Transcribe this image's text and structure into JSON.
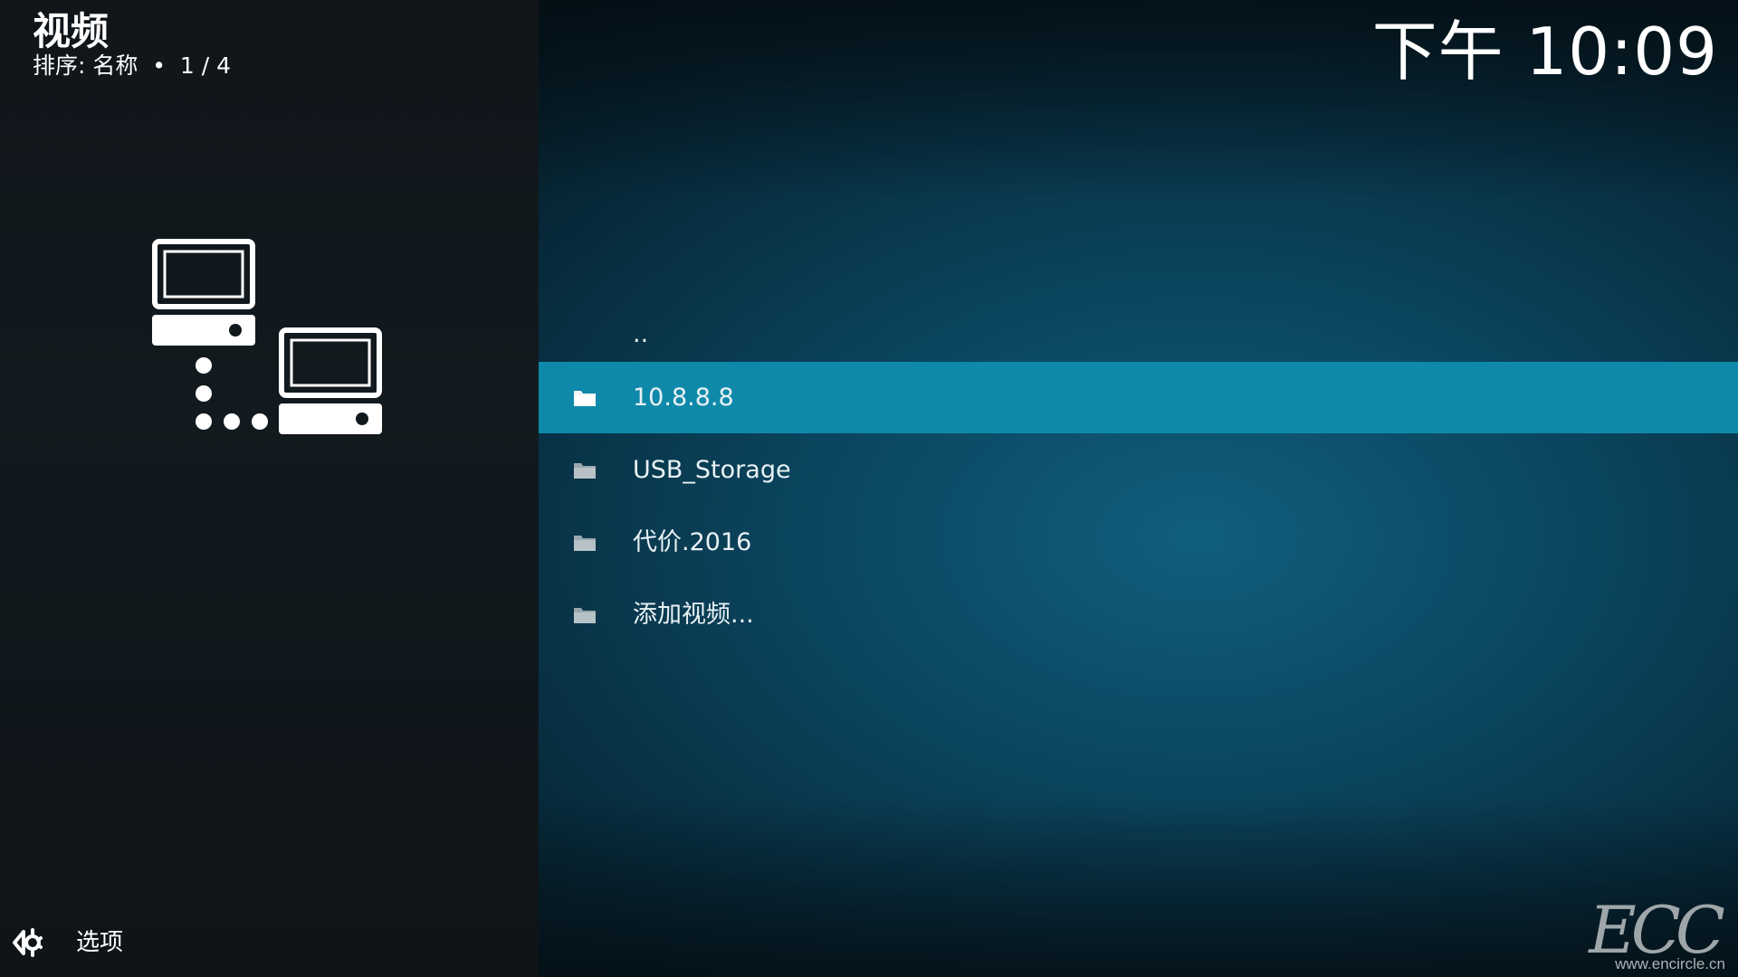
{
  "header": {
    "title": "视频",
    "sort_info": "排序: 名称  •  1 / 4",
    "clock": "下午 10:09"
  },
  "list": {
    "items": [
      {
        "label": "..",
        "icon": "",
        "focused": false
      },
      {
        "label": "10.8.8.8",
        "icon": "folder-icon",
        "focused": true
      },
      {
        "label": "USB_Storage",
        "icon": "folder-icon",
        "focused": false
      },
      {
        "label": "代价.2016",
        "icon": "folder-icon",
        "focused": false
      },
      {
        "label": "添加视频...",
        "icon": "folder-icon",
        "focused": false
      }
    ]
  },
  "footer": {
    "options_label": "选项"
  },
  "watermark": {
    "mark": "ECC",
    "url": "www.encircle.cn"
  },
  "colors": {
    "focus": "#0f89aa",
    "left_panel": "#111719",
    "right_panel": "#0b4660"
  }
}
